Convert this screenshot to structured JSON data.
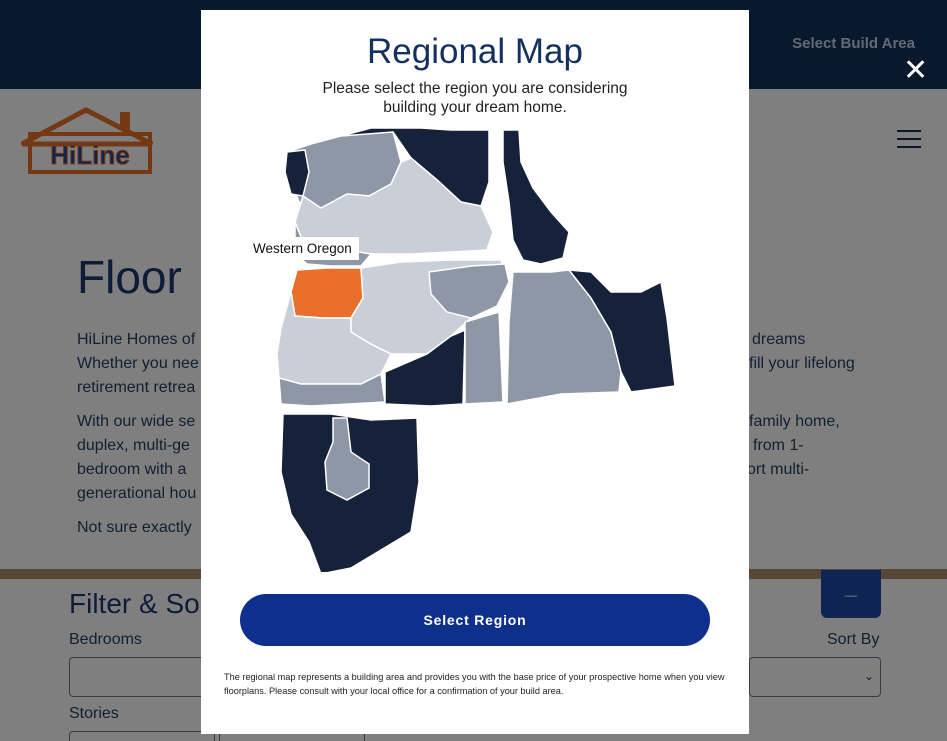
{
  "topbar": {
    "build_area_label": "Select Build Area"
  },
  "logo": {
    "brand_text": "HiLine"
  },
  "hero": {
    "title": "Floor",
    "p1_left": "HiLine Homes of",
    "p1_left_line2": "Whether you nee",
    "p1_left_line3": "retirement retrea",
    "p1_right": "dreams",
    "p1_right_line2": "fill your lifelong",
    "p2_left": "With our wide se",
    "p2_left_line2": "duplex, multi-ge",
    "p2_left_line3": "bedroom with a",
    "p2_left_line4": "generational hou",
    "p2_right": "family home,",
    "p2_right_line2": "from 1-",
    "p2_right_line3": "ort multi-",
    "p3_left": "Not sure exactly"
  },
  "filter": {
    "title": "Filter & So",
    "collapse_label": "–",
    "bedrooms_label": "Bedrooms",
    "sort_by_label": "Sort By",
    "stories_label": "Stories"
  },
  "modal": {
    "close_label": "✕",
    "title": "Regional Map",
    "subtitle": "Please select the region you are considering building your dream home.",
    "hover_region": "Western Oregon",
    "button_label": "Select Region",
    "disclaimer": "The regional map represents a building area and provides you with the base price of your prospective home when you view floorplans. Please consult with your local office for a confirmation of your build area."
  },
  "colors": {
    "navy": "#14305c",
    "region_dark": "#16213a",
    "region_mid": "#8d97a6",
    "region_light": "#c9ced7",
    "region_selected": "#e8702a",
    "button": "#0e2f8c"
  }
}
